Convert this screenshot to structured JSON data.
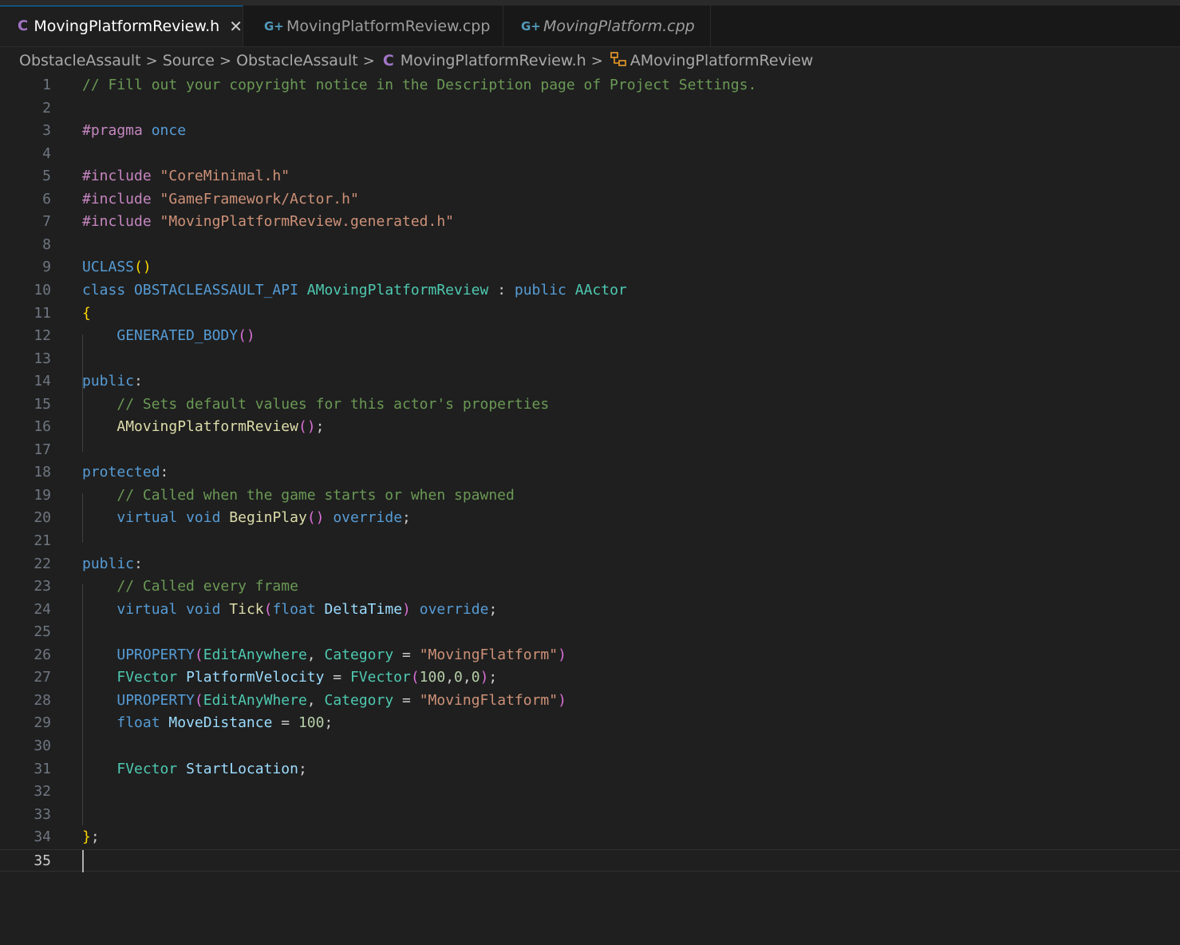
{
  "tabs": [
    {
      "icon": "C",
      "label": "MovingPlatformReview.h",
      "active": true,
      "italic": false,
      "close": "✕"
    },
    {
      "icon": "G+",
      "label": "MovingPlatformReview.cpp",
      "active": false,
      "italic": false
    },
    {
      "icon": "G+",
      "label": "MovingPlatform.cpp",
      "active": false,
      "italic": true
    }
  ],
  "breadcrumb": {
    "items": [
      "ObstacleAssault",
      "Source",
      "ObstacleAssault",
      "MovingPlatformReview.h",
      "AMovingPlatformReview"
    ],
    "file_icon": "C",
    "class_icon": "class-icon",
    "separator": ">"
  },
  "editor": {
    "current_line": 35,
    "lines": [
      {
        "n": "1",
        "tokens": [
          [
            "cm",
            "// Fill out your copyright notice in the Description page of Project Settings."
          ]
        ]
      },
      {
        "n": "2",
        "tokens": []
      },
      {
        "n": "3",
        "tokens": [
          [
            "pp",
            "#pragma"
          ],
          [
            "tx",
            " "
          ],
          [
            "kw",
            "once"
          ]
        ]
      },
      {
        "n": "4",
        "tokens": []
      },
      {
        "n": "5",
        "tokens": [
          [
            "pp",
            "#include"
          ],
          [
            "tx",
            " "
          ],
          [
            "st",
            "\"CoreMinimal.h\""
          ]
        ]
      },
      {
        "n": "6",
        "tokens": [
          [
            "pp",
            "#include"
          ],
          [
            "tx",
            " "
          ],
          [
            "st",
            "\"GameFramework/Actor.h\""
          ]
        ]
      },
      {
        "n": "7",
        "tokens": [
          [
            "pp",
            "#include"
          ],
          [
            "tx",
            " "
          ],
          [
            "st",
            "\"MovingPlatformReview.generated.h\""
          ]
        ]
      },
      {
        "n": "8",
        "tokens": []
      },
      {
        "n": "9",
        "tokens": [
          [
            "mc",
            "UCLASS"
          ],
          [
            "b1",
            "()"
          ]
        ]
      },
      {
        "n": "10",
        "tokens": [
          [
            "kw",
            "class"
          ],
          [
            "tx",
            " "
          ],
          [
            "mc",
            "OBSTACLEASSAULT_API"
          ],
          [
            "tx",
            " "
          ],
          [
            "ty",
            "AMovingPlatformReview"
          ],
          [
            "tx",
            " : "
          ],
          [
            "kw",
            "public"
          ],
          [
            "tx",
            " "
          ],
          [
            "ty",
            "AActor"
          ]
        ]
      },
      {
        "n": "11",
        "tokens": [
          [
            "b1",
            "{"
          ]
        ]
      },
      {
        "n": "12",
        "tokens": [
          [
            "tx",
            "    "
          ],
          [
            "mc",
            "GENERATED_BODY"
          ],
          [
            "b2",
            "()"
          ]
        ]
      },
      {
        "n": "13",
        "tokens": []
      },
      {
        "n": "14",
        "tokens": [
          [
            "kw",
            "public"
          ],
          [
            "tx",
            ":"
          ]
        ]
      },
      {
        "n": "15",
        "tokens": [
          [
            "tx",
            "    "
          ],
          [
            "cm",
            "// Sets default values for this actor's properties"
          ]
        ]
      },
      {
        "n": "16",
        "tokens": [
          [
            "tx",
            "    "
          ],
          [
            "fn",
            "AMovingPlatformReview"
          ],
          [
            "b2",
            "()"
          ],
          [
            "tx",
            ";"
          ]
        ]
      },
      {
        "n": "17",
        "tokens": []
      },
      {
        "n": "18",
        "tokens": [
          [
            "kw",
            "protected"
          ],
          [
            "tx",
            ":"
          ]
        ]
      },
      {
        "n": "19",
        "tokens": [
          [
            "tx",
            "    "
          ],
          [
            "cm",
            "// Called when the game starts or when spawned"
          ]
        ]
      },
      {
        "n": "20",
        "tokens": [
          [
            "tx",
            "    "
          ],
          [
            "kw",
            "virtual"
          ],
          [
            "tx",
            " "
          ],
          [
            "kw",
            "void"
          ],
          [
            "tx",
            " "
          ],
          [
            "fn",
            "BeginPlay"
          ],
          [
            "b2",
            "()"
          ],
          [
            "tx",
            " "
          ],
          [
            "kw",
            "override"
          ],
          [
            "tx",
            ";"
          ]
        ]
      },
      {
        "n": "21",
        "tokens": []
      },
      {
        "n": "22",
        "tokens": [
          [
            "kw",
            "public"
          ],
          [
            "tx",
            ":"
          ]
        ]
      },
      {
        "n": "23",
        "tokens": [
          [
            "tx",
            "    "
          ],
          [
            "cm",
            "// Called every frame"
          ]
        ]
      },
      {
        "n": "24",
        "tokens": [
          [
            "tx",
            "    "
          ],
          [
            "kw",
            "virtual"
          ],
          [
            "tx",
            " "
          ],
          [
            "kw",
            "void"
          ],
          [
            "tx",
            " "
          ],
          [
            "fn",
            "Tick"
          ],
          [
            "b2",
            "("
          ],
          [
            "kw",
            "float"
          ],
          [
            "tx",
            " "
          ],
          [
            "va",
            "DeltaTime"
          ],
          [
            "b2",
            ")"
          ],
          [
            "tx",
            " "
          ],
          [
            "kw",
            "override"
          ],
          [
            "tx",
            ";"
          ]
        ]
      },
      {
        "n": "25",
        "tokens": []
      },
      {
        "n": "26",
        "tokens": [
          [
            "tx",
            "    "
          ],
          [
            "mc",
            "UPROPERTY"
          ],
          [
            "b2",
            "("
          ],
          [
            "ty",
            "EditAnywhere"
          ],
          [
            "tx",
            ", "
          ],
          [
            "ty",
            "Category"
          ],
          [
            "tx",
            " = "
          ],
          [
            "st",
            "\"MovingFlatform\""
          ],
          [
            "b2",
            ")"
          ]
        ]
      },
      {
        "n": "27",
        "tokens": [
          [
            "tx",
            "    "
          ],
          [
            "ty",
            "FVector"
          ],
          [
            "tx",
            " "
          ],
          [
            "va",
            "PlatformVelocity"
          ],
          [
            "tx",
            " = "
          ],
          [
            "ty",
            "FVector"
          ],
          [
            "b2",
            "("
          ],
          [
            "nu",
            "100"
          ],
          [
            "tx",
            ","
          ],
          [
            "nu",
            "0"
          ],
          [
            "tx",
            ","
          ],
          [
            "nu",
            "0"
          ],
          [
            "b2",
            ")"
          ],
          [
            "tx",
            ";"
          ]
        ]
      },
      {
        "n": "28",
        "tokens": [
          [
            "tx",
            "    "
          ],
          [
            "mc",
            "UPROPERTY"
          ],
          [
            "b2",
            "("
          ],
          [
            "ty",
            "EditAnyWhere"
          ],
          [
            "tx",
            ", "
          ],
          [
            "ty",
            "Category"
          ],
          [
            "tx",
            " = "
          ],
          [
            "st",
            "\"MovingFlatform\""
          ],
          [
            "b2",
            ")"
          ]
        ]
      },
      {
        "n": "29",
        "tokens": [
          [
            "tx",
            "    "
          ],
          [
            "kw",
            "float"
          ],
          [
            "tx",
            " "
          ],
          [
            "va",
            "MoveDistance"
          ],
          [
            "tx",
            " = "
          ],
          [
            "nu",
            "100"
          ],
          [
            "tx",
            ";"
          ]
        ]
      },
      {
        "n": "30",
        "tokens": []
      },
      {
        "n": "31",
        "tokens": [
          [
            "tx",
            "    "
          ],
          [
            "ty",
            "FVector"
          ],
          [
            "tx",
            " "
          ],
          [
            "va",
            "StartLocation"
          ],
          [
            "tx",
            ";"
          ]
        ]
      },
      {
        "n": "32",
        "tokens": []
      },
      {
        "n": "33",
        "tokens": []
      },
      {
        "n": "34",
        "tokens": [
          [
            "b1",
            "}"
          ],
          [
            "tx",
            ";"
          ]
        ]
      },
      {
        "n": "35",
        "tokens": []
      }
    ]
  }
}
